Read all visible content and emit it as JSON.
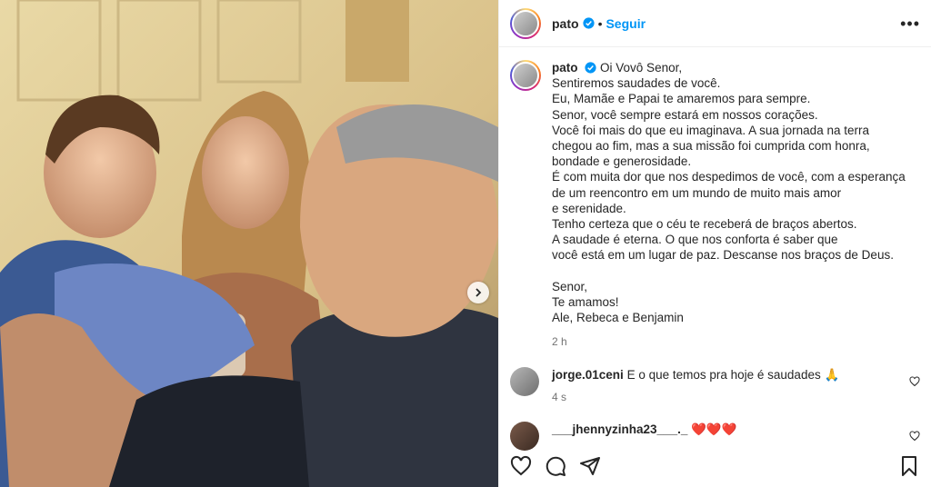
{
  "post": {
    "username": "pato",
    "follow_label": "Seguir",
    "more_label": "•••",
    "caption_lines": [
      "Oi Vovô Senor,",
      "Sentiremos saudades de você.",
      "Eu, Mamãe e Papai te amaremos para sempre.",
      "Senor, você sempre estará em nossos corações.",
      "Você foi mais do que eu imaginava. A sua jornada na terra",
      "chegou ao fim, mas a sua missão foi cumprida com honra,",
      "bondade e generosidade.",
      "É com muita dor que nos despedimos de você, com a esperança",
      "de um reencontro em um mundo de muito mais amor",
      "e serenidade.",
      "Tenho certeza que o céu te receberá de braços abertos.",
      "A saudade é eterna. O que nos conforta é saber que",
      "você está em um lugar de paz. Descanse nos braços de Deus.",
      "",
      "Senor,",
      "Te amamos!",
      "Ale, Rebeca e Benjamin"
    ],
    "time": "2 h"
  },
  "comments": [
    {
      "user": "jorge.01ceni",
      "text": "E o que temos pra hoje é saudades 🙏",
      "time": "4 s"
    },
    {
      "user": "___jhennyzinha23___._",
      "text": "❤️❤️❤️",
      "time": ""
    }
  ],
  "icons": {
    "like": "heart-icon",
    "comment": "comment-icon",
    "share": "share-icon",
    "save": "bookmark-icon",
    "next": "chevron-right-icon",
    "verified": "verified-badge-icon"
  },
  "colors": {
    "accent": "#0095f6",
    "verified": "#0095f6",
    "heart": "#ed1c3b"
  }
}
